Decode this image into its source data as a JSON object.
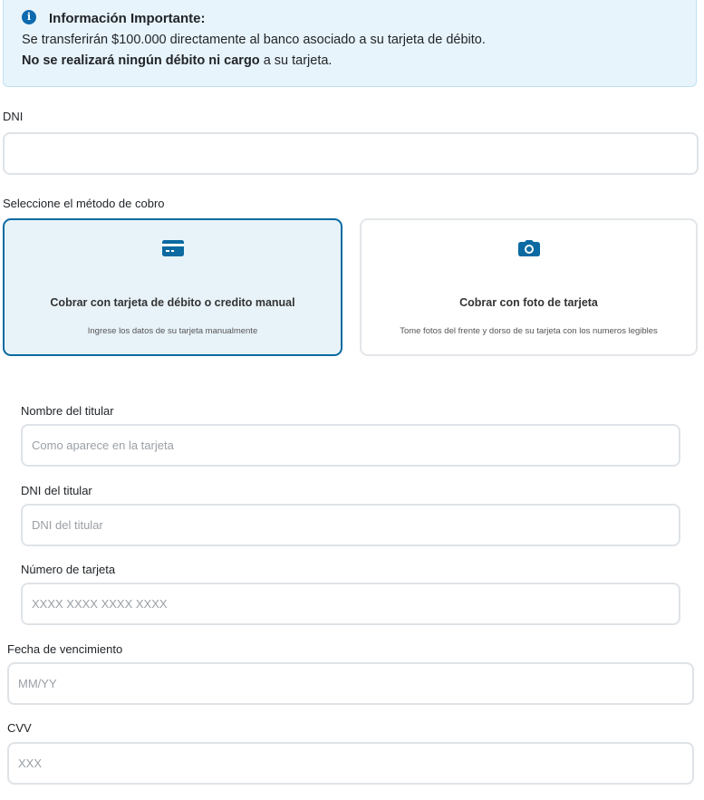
{
  "notice": {
    "title": "Información Importante:",
    "line1": "Se transferirán $100.000 directamente al banco asociado a su tarjeta de débito.",
    "line2_bold": "No se realizará ningún débito ni cargo",
    "line2_rest": " a su tarjeta.",
    "icon": "info-circle-icon"
  },
  "dni": {
    "label": "DNI",
    "value": "",
    "placeholder": ""
  },
  "method": {
    "label": "Seleccione el método de cobro",
    "options": [
      {
        "title": "Cobrar con tarjeta de débito o credito manual",
        "subtitle": "Ingrese los datos de su tarjeta manualmente",
        "icon": "credit-card-icon",
        "selected": true
      },
      {
        "title": "Cobrar con foto de tarjeta",
        "subtitle": "Tome fotos del frente y dorso de su tarjeta con los numeros legibles",
        "icon": "camera-icon",
        "selected": false
      }
    ]
  },
  "card_form": {
    "holder_name": {
      "label": "Nombre del titular",
      "placeholder": "Como aparece en la tarjeta"
    },
    "holder_dni": {
      "label": "DNI del titular",
      "placeholder": "DNI del titular"
    },
    "card_number": {
      "label": "Número de tarjeta",
      "placeholder": "XXXX XXXX XXXX XXXX"
    },
    "expiry": {
      "label": "Fecha de vencimiento",
      "placeholder": "MM/YY"
    },
    "cvv": {
      "label": "CVV",
      "placeholder": "XXX"
    }
  },
  "colors": {
    "accent": "#0a6aa1",
    "alert_bg": "#e8f4fb",
    "selected_bg": "#e8f3f9"
  }
}
